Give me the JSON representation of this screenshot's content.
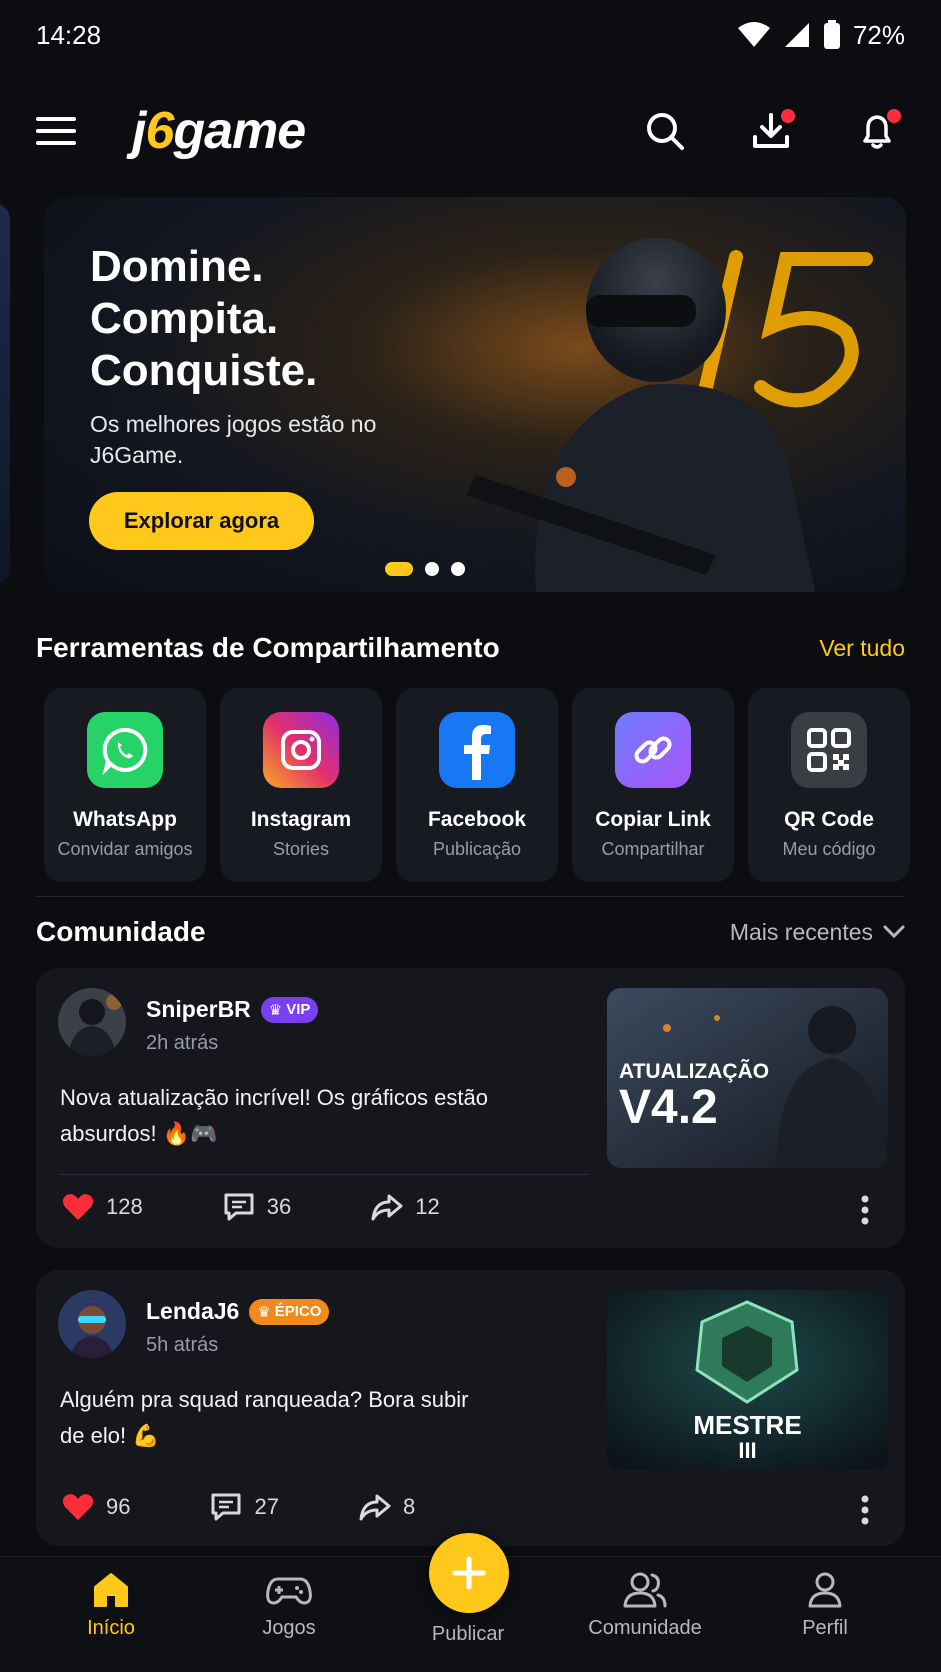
{
  "status_bar": {
    "time": "14:28",
    "battery": "72%"
  },
  "header": {
    "logo_prefix": "j",
    "logo_accent": "6",
    "logo_suffix": "game"
  },
  "hero": {
    "title": "Domine.\nCompita.\nConquiste.",
    "subtitle": "Os melhores jogos estão no J6Game.",
    "cta_label": "Explorar agora",
    "slide_count": 3,
    "active_slide": 1
  },
  "share_tools": {
    "title": "Ferramentas de Compartilhamento",
    "see_all": "Ver tudo",
    "items": [
      {
        "name": "WhatsApp",
        "sub": "Convidar amigos",
        "icon": "whatsapp-icon",
        "color": "#25d366"
      },
      {
        "name": "Instagram",
        "sub": "Stories",
        "icon": "instagram-icon",
        "color": "#e1306c"
      },
      {
        "name": "Facebook",
        "sub": "Publicação",
        "icon": "facebook-icon",
        "color": "#1877f2"
      },
      {
        "name": "Copiar Link",
        "sub": "Compartilhar",
        "icon": "link-icon",
        "color": "#8b5cf6"
      },
      {
        "name": "QR Code",
        "sub": "Meu código",
        "icon": "qr-code-icon",
        "color": "#3a3d44"
      }
    ]
  },
  "community": {
    "title": "Comunidade",
    "sort_label": "Mais recentes",
    "posts": [
      {
        "user": "SniperBR",
        "tag": "VIP",
        "time": "2h atrás",
        "text": "Nova atualização incrível! Os gráficos estão absurdos! 🔥🎮",
        "thumb_line1": "ATUALIZAÇÃO",
        "thumb_line2": "V4.2",
        "likes": "128",
        "comments": "36",
        "shares": "12"
      },
      {
        "user": "LendaJ6",
        "tag": "ÉPICO",
        "time": "5h atrás",
        "text": "Alguém pra squad ranqueada? Bora subir de elo! 💪",
        "thumb_line1": "MESTRE",
        "thumb_line2": "III",
        "likes": "96",
        "comments": "27",
        "shares": "8"
      }
    ]
  },
  "bottom_nav": {
    "items": [
      {
        "label": "Início",
        "active": true
      },
      {
        "label": "Jogos"
      },
      {
        "label": "Publicar"
      },
      {
        "label": "Comunidade"
      },
      {
        "label": "Perfil"
      }
    ]
  },
  "colors": {
    "accent": "#ffc81a",
    "background": "#0b0d11",
    "card": "#15171d",
    "like": "#ff2d3a"
  }
}
